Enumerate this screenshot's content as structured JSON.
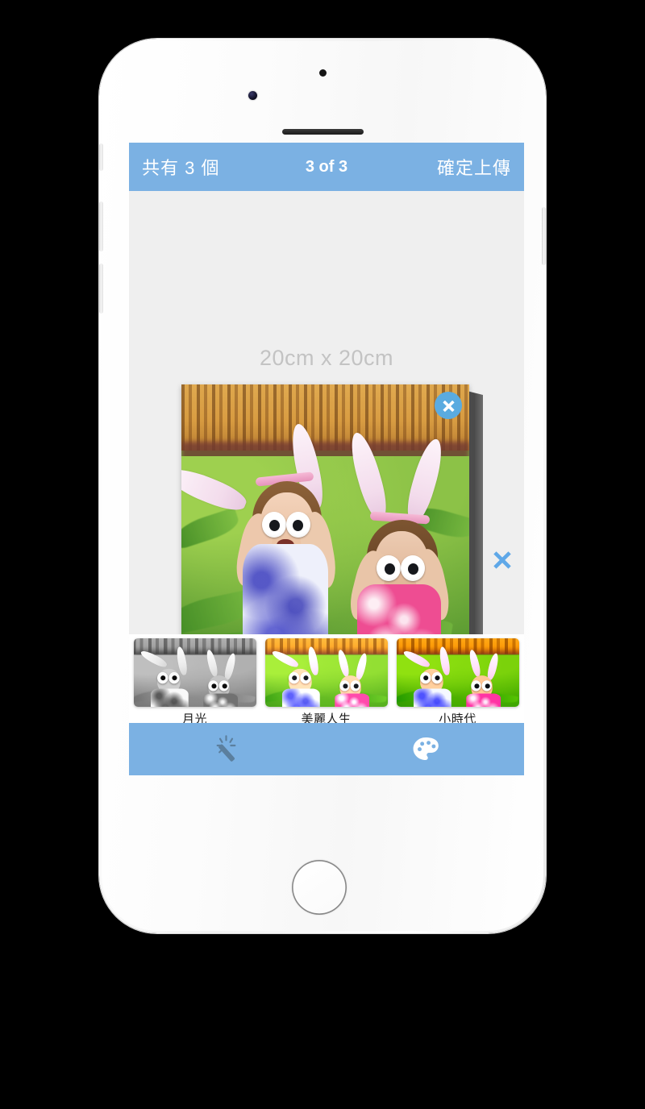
{
  "device": {
    "type": "white-smartphone",
    "camera_icon": "front-camera-icon",
    "sensor_icon": "proximity-sensor-icon",
    "speaker_icon": "earpiece-speaker-icon",
    "home_button_icon": "home-button-icon",
    "buttons": [
      "silent-switch",
      "volume-up",
      "volume-down",
      "power"
    ]
  },
  "colors": {
    "accent_blue": "#7bb1e3",
    "close_circle_blue": "#5aabe0",
    "float_x_blue": "#5fa8e8",
    "preview_background": "#efefef",
    "size_label_gray": "#c3c3c3",
    "canvas_edge_dark": "#4a4a4a",
    "strip_background": "#ffffff",
    "nav_text": "#ffffff"
  },
  "navbar": {
    "count_label": "共有 3 個",
    "title": "3 of 3",
    "upload_label": "確定上傳"
  },
  "preview": {
    "size_label": "20cm x 20cm",
    "canvas_close_icon": "close-x-circle-icon",
    "float_close_icon": "close-x-icon",
    "photo_alt": "two-girls-bunny-ears-googly-eyes-photo"
  },
  "filters": {
    "items": [
      {
        "label": "月光",
        "style": "f-mono",
        "thumb_icon": "filter-thumbnail"
      },
      {
        "label": "美麗人生",
        "style": "f-bright",
        "thumb_icon": "filter-thumbnail"
      },
      {
        "label": "小時代",
        "style": "f-vivid",
        "thumb_icon": "filter-thumbnail"
      }
    ]
  },
  "toolbar": {
    "items": [
      {
        "name": "magic-wand-icon",
        "state": "inactive"
      },
      {
        "name": "palette-icon",
        "state": "active"
      }
    ]
  }
}
